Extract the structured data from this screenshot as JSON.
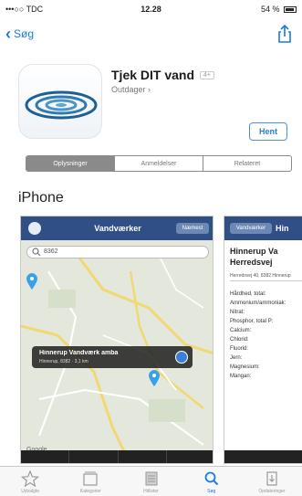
{
  "status_bar": {
    "carrier": "•••○○ TDC",
    "time": "12.28",
    "battery": "54 %"
  },
  "nav": {
    "back_label": "Søg"
  },
  "app": {
    "name": "Tjek DIT vand",
    "age_rating": "4+",
    "developer": "Outdager ›",
    "get_label": "Hent"
  },
  "segments": [
    "Oplysninger",
    "Anmeldelser",
    "Relateret"
  ],
  "section_title": "iPhone",
  "screenshot1": {
    "title": "Vandværker",
    "pill": "Næmest",
    "search_value": "8362",
    "callout_title": "Hinnerup Vandværk amba",
    "callout_subtitle": "Hinnerup, 8382 · 3,1 km",
    "credit": "Google"
  },
  "screenshot2": {
    "pill": "Vandværker",
    "label": "Hin",
    "title_line1": "Hinnerup Va",
    "title_line2": "Herredsvej",
    "address": "Herredsvej 40, 8382 Hinnerup",
    "params": [
      "Hårdhed, total:",
      "Ammonium/ammoniak:",
      "Nitrat:",
      "Phosphor, total P:",
      "Calcium:",
      "Chlorid:",
      "Fluorid:",
      "Jern:",
      "Magnesium:",
      "Mangan:"
    ]
  },
  "tab_bar": [
    {
      "label": "Udvalgte",
      "icon": "star-icon"
    },
    {
      "label": "Kategorier",
      "icon": "categories-icon"
    },
    {
      "label": "Hitlister",
      "icon": "top-charts-icon"
    },
    {
      "label": "Søg",
      "icon": "search-icon"
    },
    {
      "label": "Opdateringer",
      "icon": "updates-icon"
    }
  ],
  "colors": {
    "accent": "#1a7be0",
    "nav_blue": "#2f4f86"
  }
}
